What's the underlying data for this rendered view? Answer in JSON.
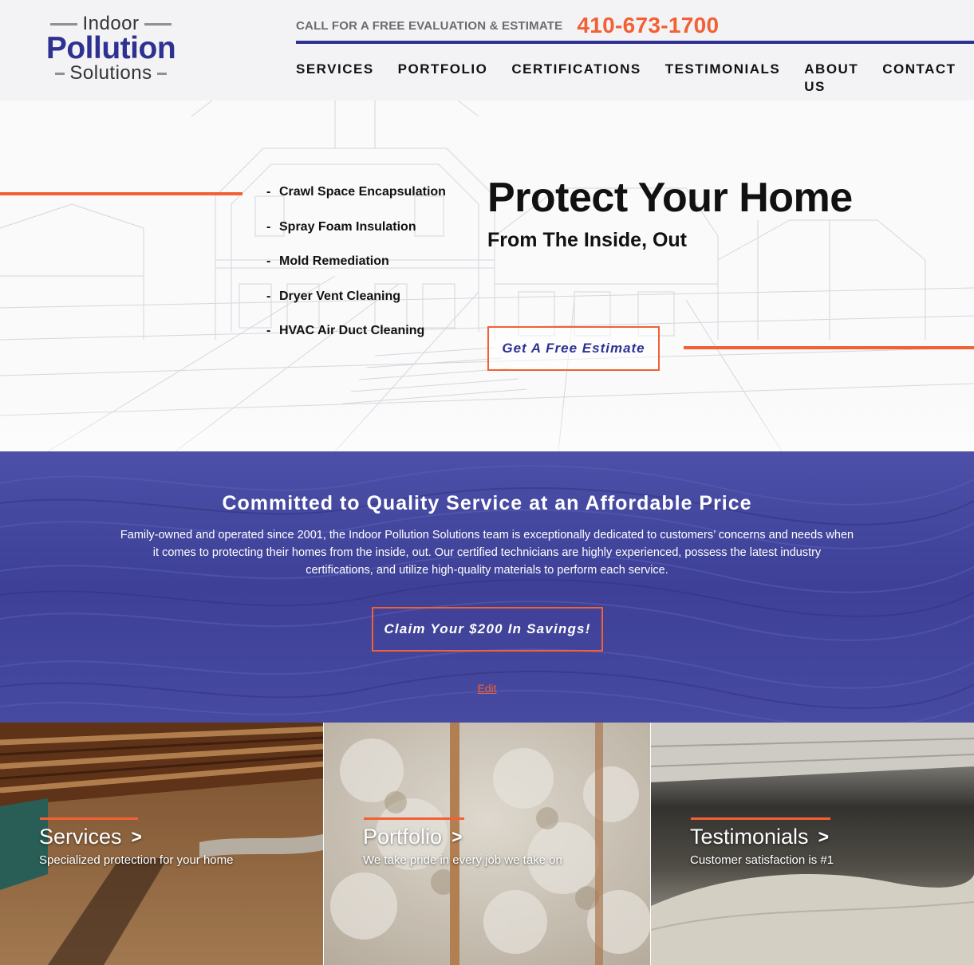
{
  "logo": {
    "line1": "Indoor",
    "line2": "Pollution",
    "line3": "Solutions"
  },
  "header": {
    "call_text": "CALL FOR A FREE EVALUATION & ESTIMATE",
    "phone": "410-673-1700"
  },
  "nav": {
    "items": [
      {
        "label": "SERVICES"
      },
      {
        "label": "PORTFOLIO"
      },
      {
        "label": "CERTIFICATIONS"
      },
      {
        "label": "TESTIMONIALS"
      },
      {
        "label": "ABOUT US"
      },
      {
        "label": "CONTACT"
      }
    ]
  },
  "hero": {
    "bullet": "-",
    "services": [
      "Crawl Space Encapsulation",
      "Spray Foam Insulation",
      "Mold Remediation",
      "Dryer Vent Cleaning",
      "HVAC Air Duct Cleaning"
    ],
    "title": "Protect Your Home",
    "subtitle": "From The Inside, Out",
    "cta_label": "Get A Free Estimate"
  },
  "band": {
    "title": "Committed to Quality Service at an Affordable Price",
    "text": "Family-owned and operated since 2001, the Indoor Pollution Solutions team is exceptionally dedicated to customers’ concerns and needs when it comes to protecting their homes from the inside, out. Our certified technicians are highly experienced, possess the latest industry certifications, and utilize high-quality materials to perform each service.",
    "cta_label": "Claim Your $200 In Savings!",
    "edit_label": "Edit"
  },
  "cards": [
    {
      "title": "Services",
      "arrow": ">",
      "subtitle": "Specialized protection for your home"
    },
    {
      "title": "Portfolio",
      "arrow": ">",
      "subtitle": "We take pride in every job we take on"
    },
    {
      "title": "Testimonials",
      "arrow": ">",
      "subtitle": "Customer satisfaction is #1"
    }
  ],
  "colors": {
    "brand_blue": "#2e3192",
    "accent_orange": "#f26033",
    "band_blue": "#3f4299"
  }
}
